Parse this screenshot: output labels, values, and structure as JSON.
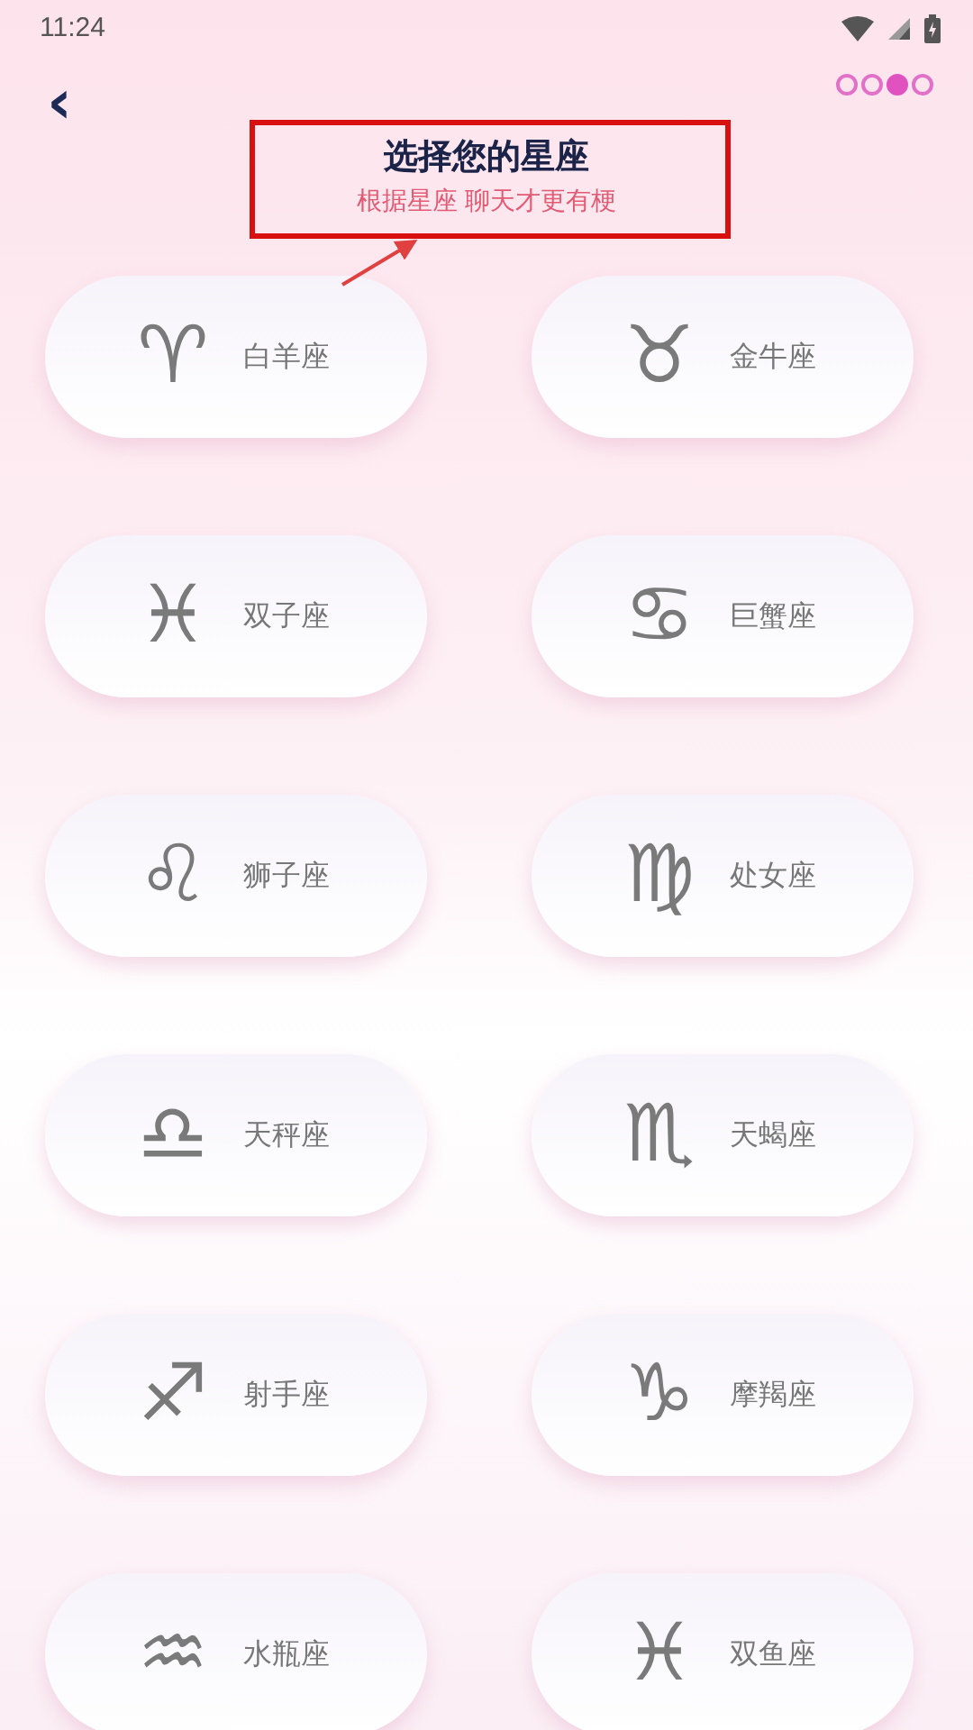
{
  "status_bar": {
    "time": "11:24"
  },
  "steps": [
    {
      "selected": false
    },
    {
      "selected": false
    },
    {
      "selected": true
    },
    {
      "selected": false
    }
  ],
  "back": {
    "symbol": "‹"
  },
  "header": {
    "title": "选择您的星座",
    "subtitle": "根据星座 聊天才更有梗"
  },
  "signs": [
    {
      "symbol": "♈︎",
      "label": "白羊座"
    },
    {
      "symbol": "♉︎",
      "label": "金牛座"
    },
    {
      "symbol": "♓︎",
      "label": "双子座"
    },
    {
      "symbol": "♋︎",
      "label": "巨蟹座"
    },
    {
      "symbol": "♌︎",
      "label": "狮子座"
    },
    {
      "symbol": "♍︎",
      "label": "处女座"
    },
    {
      "symbol": "♎︎",
      "label": "天秤座"
    },
    {
      "symbol": "♏︎",
      "label": "天蝎座"
    },
    {
      "symbol": "♐︎",
      "label": "射手座"
    },
    {
      "symbol": "♑︎",
      "label": "摩羯座"
    },
    {
      "symbol": "♒︎",
      "label": "水瓶座"
    },
    {
      "symbol": "♓︎",
      "label": "双鱼座"
    }
  ],
  "annotation": {
    "kind": "box-arrow"
  }
}
